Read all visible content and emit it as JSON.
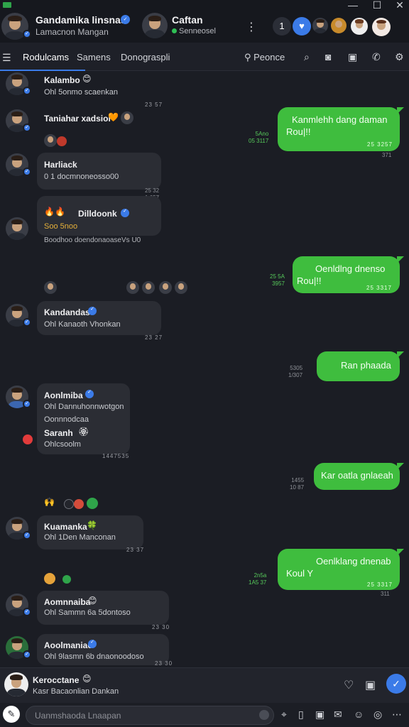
{
  "header": {
    "title": "Gandamika linsnas",
    "subtitle": "Lamacnon Mangan",
    "contact_name": "Caftan",
    "contact_status": "Senneosel",
    "pill_count": "1"
  },
  "tabs": [
    "Rodulcams",
    "Samens",
    "Donograspli"
  ],
  "tab_right": "Peonce",
  "messages": [
    {
      "sender": "Kalambo",
      "text": "Ohl 5onmo scaenkan",
      "time": "23 57"
    },
    {
      "sender": "Taniahar xadsior",
      "time": "",
      "text": ""
    },
    {
      "out": true,
      "text1": "Kanmlehh dang daman",
      "text2": "Rou|!!",
      "time": "25 3257",
      "side": "5Ano\n05 3117",
      "under": "371"
    },
    {
      "sender": "Harliack",
      "text": "0 1 docmnoneosso00",
      "time": "25 32\n1 657"
    },
    {
      "sender": "Dilldoonk",
      "text": "Soo 5noo",
      "subline": "Boodhoo doendonaoaseVs U0",
      "time": ""
    },
    {
      "out": true,
      "text1": "Oenldlng dnenso",
      "text2": "Rou|!!",
      "time": "25 3317",
      "side": "25 5A\n3957"
    },
    {
      "sender": "Kandandas",
      "text": "Ohl Kanaoth Vhonkan",
      "time": "23 27"
    },
    {
      "out": true,
      "text1": "Ran phaada",
      "time": "",
      "side": "5305\n1/307"
    },
    {
      "sender": "Aonlmiba",
      "text": "Ohl Dannuhonnwotgon",
      "text2": "Oonnnodcaa",
      "sender2": "Saranh",
      "text3": "Ohlcsoolm",
      "time": "1447535"
    },
    {
      "out": true,
      "text1": "Kar oatla gnlaeah",
      "time": "",
      "side": "1455\n10 87"
    },
    {
      "sender": "Kuamanka",
      "text": "Ohl 1Den Manconan",
      "time": "23 37"
    },
    {
      "out": true,
      "text1": "Oenlklang dnenab",
      "text2": "Koul Y",
      "time": "25 3317",
      "side": "2n5a\n1A5 37",
      "under": "311"
    },
    {
      "sender": "Aomnnaiba",
      "text": "Ohl Sammn 6a 5dontoso",
      "time": "23 30"
    },
    {
      "sender": "Aoolmaniae",
      "text": "Ohl 9lasmn 6b dnaonoodoso",
      "time": "23 30"
    }
  ],
  "pinned": {
    "name": "Kerocctane",
    "text": "Kasr Bacaonlian Dankan"
  },
  "composer": {
    "placeholder": "Uanmshaoda Lnaapan"
  },
  "colors": {
    "accent": "#3b7be8",
    "outgoing": "#3fbd3e",
    "background": "#1b1d24"
  }
}
